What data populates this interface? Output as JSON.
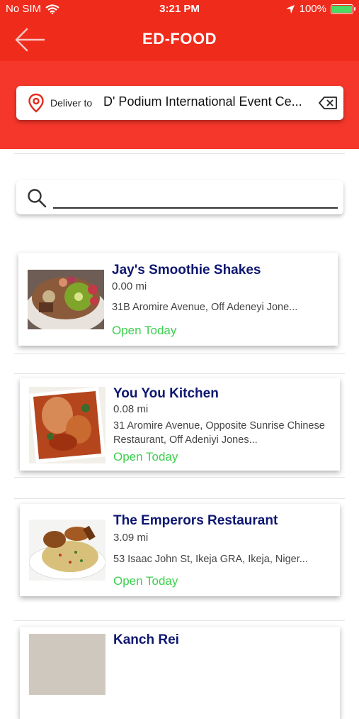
{
  "status_bar": {
    "carrier": "No SIM",
    "time": "3:21 PM",
    "battery_percent": "100%",
    "icons": [
      "wifi-icon",
      "location-arrow-icon",
      "battery-icon"
    ]
  },
  "nav": {
    "title": "ED-FOOD",
    "back_icon": "arrow-left-icon"
  },
  "delivery": {
    "label": "Deliver to",
    "address": "D' Podium International Event Ce...",
    "pin_icon": "map-pin-icon",
    "clear_icon": "backspace-icon"
  },
  "search": {
    "value": "",
    "placeholder": "",
    "icon": "search-icon"
  },
  "restaurants": [
    {
      "name": "Jay's Smoothie Shakes",
      "distance": "0.00 mi",
      "address": "31B Aromire Avenue, Off Adeneyi Jone...",
      "status": "Open Today"
    },
    {
      "name": "You You Kitchen",
      "distance": "0.08 mi",
      "address": "31 Aromire Avenue, Opposite Sunrise Chinese Restaurant, Off Adeniyi Jones...",
      "status": "Open Today"
    },
    {
      "name": "The Emperors Restaurant",
      "distance": "3.09 mi",
      "address": "53 Isaac John St, Ikeja GRA, Ikeja, Niger...",
      "status": "Open Today"
    },
    {
      "name": "Kanch Rei",
      "distance": "",
      "address": "",
      "status": ""
    }
  ],
  "colors": {
    "header_red": "#ef2b1b",
    "band_red": "#f5362b",
    "name_navy": "#0d1670",
    "open_green": "#3ccf4e"
  }
}
